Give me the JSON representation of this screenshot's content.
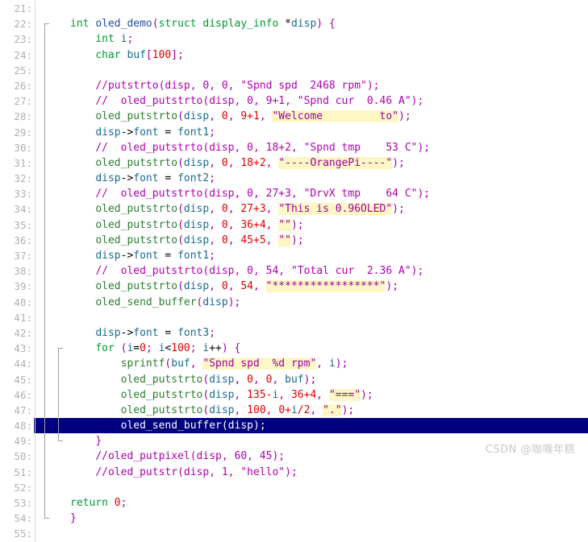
{
  "editor": {
    "first_line_number": 21,
    "last_line_number": 55,
    "selected_line_number": 48,
    "gutter_separator": ":",
    "colors": {
      "background": "#ffffff",
      "line_number": "#b0b0b0",
      "keyword": "#009933",
      "function": "#2e7d32",
      "punctuation": "#a000a0",
      "number": "#e00000",
      "identifier": "#1a6b8f",
      "string": "#a000a0",
      "comment": "#b000b0",
      "search_highlight": "#fcf7c5",
      "selection_background": "#000080",
      "selection_text": "#ffffff"
    }
  },
  "watermark": {
    "text": "CSDN @咖喱年糕"
  },
  "lines": [
    {
      "n": "21",
      "tokens": []
    },
    {
      "n": "22",
      "fold": "start",
      "tokens": [
        {
          "t": "int",
          "c": "t-kw"
        },
        {
          "t": " ",
          "c": "t-plain"
        },
        {
          "t": "oled_demo",
          "c": "t-fn"
        },
        {
          "t": "(",
          "c": "t-punct"
        },
        {
          "t": "struct",
          "c": "t-kw"
        },
        {
          "t": " ",
          "c": "t-plain"
        },
        {
          "t": "display_info",
          "c": "t-kw"
        },
        {
          "t": " ",
          "c": "t-plain"
        },
        {
          "t": "*",
          "c": "t-op"
        },
        {
          "t": "disp",
          "c": "t-ident"
        },
        {
          "t": ")",
          "c": "t-punct"
        },
        {
          "t": " ",
          "c": "t-plain"
        },
        {
          "t": "{",
          "c": "t-punct"
        }
      ]
    },
    {
      "n": "23",
      "tokens": [
        {
          "t": "    ",
          "c": "t-plain"
        },
        {
          "t": "int",
          "c": "t-kw"
        },
        {
          "t": " ",
          "c": "t-plain"
        },
        {
          "t": "i",
          "c": "t-ident"
        },
        {
          "t": ";",
          "c": "t-punct"
        }
      ]
    },
    {
      "n": "24",
      "tokens": [
        {
          "t": "    ",
          "c": "t-plain"
        },
        {
          "t": "char",
          "c": "t-kw"
        },
        {
          "t": " ",
          "c": "t-plain"
        },
        {
          "t": "buf",
          "c": "t-ident"
        },
        {
          "t": "[",
          "c": "t-punct"
        },
        {
          "t": "100",
          "c": "t-num"
        },
        {
          "t": "];",
          "c": "t-punct"
        }
      ]
    },
    {
      "n": "25",
      "tokens": []
    },
    {
      "n": "26",
      "tokens": [
        {
          "t": "    ",
          "c": "t-plain"
        },
        {
          "t": "//putstrto(disp, 0, 0, \"Spnd spd  2468 rpm\");",
          "c": "t-cmt"
        }
      ]
    },
    {
      "n": "27",
      "tokens": [
        {
          "t": "    ",
          "c": "t-plain"
        },
        {
          "t": "//  oled_putstrto(disp, 0, 9+1, \"Spnd cur  0.46 A\");",
          "c": "t-cmt"
        }
      ]
    },
    {
      "n": "28",
      "tokens": [
        {
          "t": "    ",
          "c": "t-plain"
        },
        {
          "t": "oled_putstrto",
          "c": "t-fn2"
        },
        {
          "t": "(",
          "c": "t-punct"
        },
        {
          "t": "disp",
          "c": "t-ident"
        },
        {
          "t": ", ",
          "c": "t-punct"
        },
        {
          "t": "0",
          "c": "t-num"
        },
        {
          "t": ", ",
          "c": "t-punct"
        },
        {
          "t": "9",
          "c": "t-num"
        },
        {
          "t": "+",
          "c": "t-num"
        },
        {
          "t": "1",
          "c": "t-num"
        },
        {
          "t": ", ",
          "c": "t-punct"
        },
        {
          "t": "\"Welcome         to\"",
          "c": "t-str hl"
        },
        {
          "t": ");",
          "c": "t-punct"
        }
      ]
    },
    {
      "n": "29",
      "tokens": [
        {
          "t": "    ",
          "c": "t-plain"
        },
        {
          "t": "disp",
          "c": "t-ident"
        },
        {
          "t": "->",
          "c": "t-op"
        },
        {
          "t": "font",
          "c": "t-ident"
        },
        {
          "t": " = ",
          "c": "t-op"
        },
        {
          "t": "font1",
          "c": "t-ident"
        },
        {
          "t": ";",
          "c": "t-punct"
        }
      ]
    },
    {
      "n": "30",
      "tokens": [
        {
          "t": "    ",
          "c": "t-plain"
        },
        {
          "t": "//  oled_putstrto(disp, 0, 18+2, \"Spnd tmp    53 C\");",
          "c": "t-cmt"
        }
      ]
    },
    {
      "n": "31",
      "tokens": [
        {
          "t": "    ",
          "c": "t-plain"
        },
        {
          "t": "oled_putstrto",
          "c": "t-fn2"
        },
        {
          "t": "(",
          "c": "t-punct"
        },
        {
          "t": "disp",
          "c": "t-ident"
        },
        {
          "t": ", ",
          "c": "t-punct"
        },
        {
          "t": "0",
          "c": "t-num"
        },
        {
          "t": ", ",
          "c": "t-punct"
        },
        {
          "t": "18",
          "c": "t-num"
        },
        {
          "t": "+",
          "c": "t-num"
        },
        {
          "t": "2",
          "c": "t-num"
        },
        {
          "t": ", ",
          "c": "t-punct"
        },
        {
          "t": "\"----OrangePi----\"",
          "c": "t-str hl"
        },
        {
          "t": ");",
          "c": "t-punct"
        }
      ]
    },
    {
      "n": "32",
      "tokens": [
        {
          "t": "    ",
          "c": "t-plain"
        },
        {
          "t": "disp",
          "c": "t-ident"
        },
        {
          "t": "->",
          "c": "t-op"
        },
        {
          "t": "font",
          "c": "t-ident"
        },
        {
          "t": " = ",
          "c": "t-op"
        },
        {
          "t": "font2",
          "c": "t-ident"
        },
        {
          "t": ";",
          "c": "t-punct"
        }
      ]
    },
    {
      "n": "33",
      "tokens": [
        {
          "t": "    ",
          "c": "t-plain"
        },
        {
          "t": "//  oled_putstrto(disp, 0, 27+3, \"DrvX tmp    64 C\");",
          "c": "t-cmt"
        }
      ]
    },
    {
      "n": "34",
      "tokens": [
        {
          "t": "    ",
          "c": "t-plain"
        },
        {
          "t": "oled_putstrto",
          "c": "t-fn2"
        },
        {
          "t": "(",
          "c": "t-punct"
        },
        {
          "t": "disp",
          "c": "t-ident"
        },
        {
          "t": ", ",
          "c": "t-punct"
        },
        {
          "t": "0",
          "c": "t-num"
        },
        {
          "t": ", ",
          "c": "t-punct"
        },
        {
          "t": "27",
          "c": "t-num"
        },
        {
          "t": "+",
          "c": "t-num"
        },
        {
          "t": "3",
          "c": "t-num"
        },
        {
          "t": ", ",
          "c": "t-punct"
        },
        {
          "t": "\"This is 0.96OLED\"",
          "c": "t-str hl"
        },
        {
          "t": ");",
          "c": "t-punct"
        }
      ]
    },
    {
      "n": "35",
      "tokens": [
        {
          "t": "    ",
          "c": "t-plain"
        },
        {
          "t": "oled_putstrto",
          "c": "t-fn2"
        },
        {
          "t": "(",
          "c": "t-punct"
        },
        {
          "t": "disp",
          "c": "t-ident"
        },
        {
          "t": ", ",
          "c": "t-punct"
        },
        {
          "t": "0",
          "c": "t-num"
        },
        {
          "t": ", ",
          "c": "t-punct"
        },
        {
          "t": "36",
          "c": "t-num"
        },
        {
          "t": "+",
          "c": "t-num"
        },
        {
          "t": "4",
          "c": "t-num"
        },
        {
          "t": ", ",
          "c": "t-punct"
        },
        {
          "t": "\"\"",
          "c": "t-str hl"
        },
        {
          "t": ");",
          "c": "t-punct"
        }
      ]
    },
    {
      "n": "36",
      "tokens": [
        {
          "t": "    ",
          "c": "t-plain"
        },
        {
          "t": "oled_putstrto",
          "c": "t-fn2"
        },
        {
          "t": "(",
          "c": "t-punct"
        },
        {
          "t": "disp",
          "c": "t-ident"
        },
        {
          "t": ", ",
          "c": "t-punct"
        },
        {
          "t": "0",
          "c": "t-num"
        },
        {
          "t": ", ",
          "c": "t-punct"
        },
        {
          "t": "45",
          "c": "t-num"
        },
        {
          "t": "+",
          "c": "t-num"
        },
        {
          "t": "5",
          "c": "t-num"
        },
        {
          "t": ", ",
          "c": "t-punct"
        },
        {
          "t": "\"\"",
          "c": "t-str hl"
        },
        {
          "t": ");",
          "c": "t-punct"
        }
      ]
    },
    {
      "n": "37",
      "tokens": [
        {
          "t": "    ",
          "c": "t-plain"
        },
        {
          "t": "disp",
          "c": "t-ident"
        },
        {
          "t": "->",
          "c": "t-op"
        },
        {
          "t": "font",
          "c": "t-ident"
        },
        {
          "t": " = ",
          "c": "t-op"
        },
        {
          "t": "font1",
          "c": "t-ident"
        },
        {
          "t": ";",
          "c": "t-punct"
        }
      ]
    },
    {
      "n": "38",
      "tokens": [
        {
          "t": "    ",
          "c": "t-plain"
        },
        {
          "t": "//  oled_putstrto(disp, 0, 54, \"Total cur  2.36 A\");",
          "c": "t-cmt"
        }
      ]
    },
    {
      "n": "39",
      "tokens": [
        {
          "t": "    ",
          "c": "t-plain"
        },
        {
          "t": "oled_putstrto",
          "c": "t-fn2"
        },
        {
          "t": "(",
          "c": "t-punct"
        },
        {
          "t": "disp",
          "c": "t-ident"
        },
        {
          "t": ", ",
          "c": "t-punct"
        },
        {
          "t": "0",
          "c": "t-num"
        },
        {
          "t": ", ",
          "c": "t-punct"
        },
        {
          "t": "54",
          "c": "t-num"
        },
        {
          "t": ", ",
          "c": "t-punct"
        },
        {
          "t": "\"*****************\"",
          "c": "t-str hl"
        },
        {
          "t": ");",
          "c": "t-punct"
        }
      ]
    },
    {
      "n": "40",
      "tokens": [
        {
          "t": "    ",
          "c": "t-plain"
        },
        {
          "t": "oled_send_buffer",
          "c": "t-fn2"
        },
        {
          "t": "(",
          "c": "t-punct"
        },
        {
          "t": "disp",
          "c": "t-ident"
        },
        {
          "t": ");",
          "c": "t-punct"
        }
      ]
    },
    {
      "n": "41",
      "tokens": []
    },
    {
      "n": "42",
      "tokens": [
        {
          "t": "    ",
          "c": "t-plain"
        },
        {
          "t": "disp",
          "c": "t-ident"
        },
        {
          "t": "->",
          "c": "t-op"
        },
        {
          "t": "font",
          "c": "t-ident"
        },
        {
          "t": " = ",
          "c": "t-op"
        },
        {
          "t": "font3",
          "c": "t-ident"
        },
        {
          "t": ";",
          "c": "t-punct"
        }
      ]
    },
    {
      "n": "43",
      "fold": "inner-start",
      "tokens": [
        {
          "t": "    ",
          "c": "t-plain"
        },
        {
          "t": "for",
          "c": "t-kw"
        },
        {
          "t": " ",
          "c": "t-plain"
        },
        {
          "t": "(",
          "c": "t-punct"
        },
        {
          "t": "i",
          "c": "t-ident"
        },
        {
          "t": "=",
          "c": "t-op"
        },
        {
          "t": "0",
          "c": "t-num"
        },
        {
          "t": "; ",
          "c": "t-punct"
        },
        {
          "t": "i",
          "c": "t-ident"
        },
        {
          "t": "<",
          "c": "t-op"
        },
        {
          "t": "100",
          "c": "t-num"
        },
        {
          "t": "; ",
          "c": "t-punct"
        },
        {
          "t": "i",
          "c": "t-ident"
        },
        {
          "t": "++",
          "c": "t-op"
        },
        {
          "t": ") ",
          "c": "t-punct"
        },
        {
          "t": "{",
          "c": "t-punct"
        }
      ]
    },
    {
      "n": "44",
      "fold": "inner",
      "tokens": [
        {
          "t": "        ",
          "c": "t-plain"
        },
        {
          "t": "sprintf",
          "c": "t-fn2"
        },
        {
          "t": "(",
          "c": "t-punct"
        },
        {
          "t": "buf",
          "c": "t-ident"
        },
        {
          "t": ", ",
          "c": "t-punct"
        },
        {
          "t": "\"Spnd spd  %d rpm\"",
          "c": "t-str hl"
        },
        {
          "t": ", ",
          "c": "t-punct"
        },
        {
          "t": "i",
          "c": "t-ident"
        },
        {
          "t": ");",
          "c": "t-punct"
        }
      ]
    },
    {
      "n": "45",
      "fold": "inner",
      "tokens": [
        {
          "t": "        ",
          "c": "t-plain"
        },
        {
          "t": "oled_putstrto",
          "c": "t-fn2"
        },
        {
          "t": "(",
          "c": "t-punct"
        },
        {
          "t": "disp",
          "c": "t-ident"
        },
        {
          "t": ", ",
          "c": "t-punct"
        },
        {
          "t": "0",
          "c": "t-num"
        },
        {
          "t": ", ",
          "c": "t-punct"
        },
        {
          "t": "0",
          "c": "t-num"
        },
        {
          "t": ", ",
          "c": "t-punct"
        },
        {
          "t": "buf",
          "c": "t-ident"
        },
        {
          "t": ");",
          "c": "t-punct"
        }
      ]
    },
    {
      "n": "46",
      "fold": "inner",
      "tokens": [
        {
          "t": "        ",
          "c": "t-plain"
        },
        {
          "t": "oled_putstrto",
          "c": "t-fn2"
        },
        {
          "t": "(",
          "c": "t-punct"
        },
        {
          "t": "disp",
          "c": "t-ident"
        },
        {
          "t": ", ",
          "c": "t-punct"
        },
        {
          "t": "135",
          "c": "t-num"
        },
        {
          "t": "-",
          "c": "t-num"
        },
        {
          "t": "i",
          "c": "t-ident"
        },
        {
          "t": ", ",
          "c": "t-punct"
        },
        {
          "t": "36",
          "c": "t-num"
        },
        {
          "t": "+",
          "c": "t-num"
        },
        {
          "t": "4",
          "c": "t-num"
        },
        {
          "t": ", ",
          "c": "t-punct"
        },
        {
          "t": "\"===\"",
          "c": "t-str hl"
        },
        {
          "t": ");",
          "c": "t-punct"
        }
      ]
    },
    {
      "n": "47",
      "fold": "inner",
      "tokens": [
        {
          "t": "        ",
          "c": "t-plain"
        },
        {
          "t": "oled_putstrto",
          "c": "t-fn2"
        },
        {
          "t": "(",
          "c": "t-punct"
        },
        {
          "t": "disp",
          "c": "t-ident"
        },
        {
          "t": ", ",
          "c": "t-punct"
        },
        {
          "t": "100",
          "c": "t-num"
        },
        {
          "t": ", ",
          "c": "t-punct"
        },
        {
          "t": "0",
          "c": "t-num"
        },
        {
          "t": "+",
          "c": "t-num"
        },
        {
          "t": "i",
          "c": "t-ident"
        },
        {
          "t": "/",
          "c": "t-num"
        },
        {
          "t": "2",
          "c": "t-num"
        },
        {
          "t": ", ",
          "c": "t-punct"
        },
        {
          "t": "\".\"",
          "c": "t-str hl"
        },
        {
          "t": ");",
          "c": "t-punct"
        }
      ]
    },
    {
      "n": "48",
      "selected": true,
      "fold": "inner",
      "tokens": [
        {
          "t": "        ",
          "c": "t-plain"
        },
        {
          "t": "oled_send_buffer",
          "c": "t-fn2"
        },
        {
          "t": "(",
          "c": "t-punct"
        },
        {
          "t": "disp",
          "c": "t-ident"
        },
        {
          "t": ");",
          "c": "t-punct"
        }
      ]
    },
    {
      "n": "49",
      "fold": "inner-end",
      "tokens": [
        {
          "t": "    ",
          "c": "t-plain"
        },
        {
          "t": "}",
          "c": "t-punct"
        }
      ]
    },
    {
      "n": "50",
      "tokens": [
        {
          "t": "    ",
          "c": "t-plain"
        },
        {
          "t": "//oled_putpixel(disp, 60, 45);",
          "c": "t-cmt"
        }
      ]
    },
    {
      "n": "51",
      "tokens": [
        {
          "t": "    ",
          "c": "t-plain"
        },
        {
          "t": "//oled_putstr(disp, 1, \"hello\");",
          "c": "t-cmt"
        }
      ]
    },
    {
      "n": "52",
      "tokens": []
    },
    {
      "n": "53",
      "tokens": [
        {
          "t": "return",
          "c": "t-kw"
        },
        {
          "t": " ",
          "c": "t-plain"
        },
        {
          "t": "0",
          "c": "t-num"
        },
        {
          "t": ";",
          "c": "t-punct"
        }
      ]
    },
    {
      "n": "54",
      "fold": "end",
      "tokens": [
        {
          "t": "}",
          "c": "t-punct"
        }
      ]
    },
    {
      "n": "55",
      "tokens": []
    }
  ]
}
